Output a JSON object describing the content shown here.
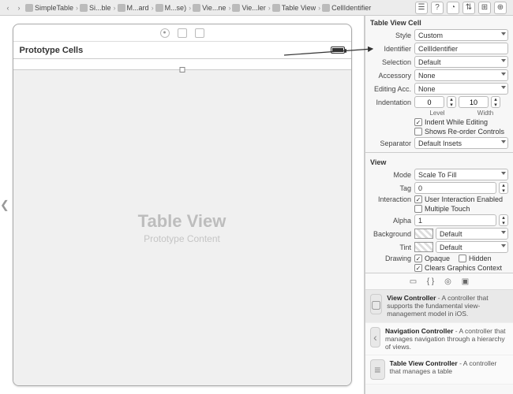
{
  "breadcrumb": [
    "SimpleTable",
    "Si...ble",
    "M...ard",
    "M...se)",
    "Vie...ne",
    "Vie...ler",
    "Table View",
    "CellIdentifier"
  ],
  "canvas": {
    "proto_header": "Prototype Cells",
    "tv_title": "Table View",
    "tv_sub": "Prototype Content"
  },
  "cell": {
    "section": "Table View Cell",
    "style_k": "Style",
    "style_v": "Custom",
    "ident_k": "Identifier",
    "ident_v": "CellIdentifier",
    "sel_k": "Selection",
    "sel_v": "Default",
    "acc_k": "Accessory",
    "acc_v": "None",
    "eacc_k": "Editing Acc.",
    "eacc_v": "None",
    "indent_k": "Indentation",
    "indent_lvl": "0",
    "indent_w": "10",
    "indent_lvl_lab": "Level",
    "indent_w_lab": "Width",
    "ck_indent": "Indent While Editing",
    "ck_reorder": "Shows Re-order Controls",
    "sep_k": "Separator",
    "sep_v": "Default Insets"
  },
  "view": {
    "section": "View",
    "mode_k": "Mode",
    "mode_v": "Scale To Fill",
    "tag_k": "Tag",
    "tag_v": "0",
    "inter_k": "Interaction",
    "ck_uie": "User Interaction Enabled",
    "ck_mt": "Multiple Touch",
    "alpha_k": "Alpha",
    "alpha_v": "1",
    "bg_k": "Background",
    "bg_v": "Default",
    "tint_k": "Tint",
    "tint_v": "Default",
    "draw_k": "Drawing",
    "ck_op": "Opaque",
    "ck_hid": "Hidden",
    "ck_cgc": "Clears Graphics Context"
  },
  "library": {
    "vc_t": "View Controller",
    "vc_d": " - A controller that supports the fundamental view-management model in iOS.",
    "nc_t": "Navigation Controller",
    "nc_d": " - A controller that manages navigation through a hierarchy of views.",
    "tc_t": "Table View Controller",
    "tc_d": " - A controller that manages a table"
  },
  "head_icons": [
    "☰",
    "?",
    "◔",
    "⇅",
    "⊞",
    "⊕"
  ]
}
